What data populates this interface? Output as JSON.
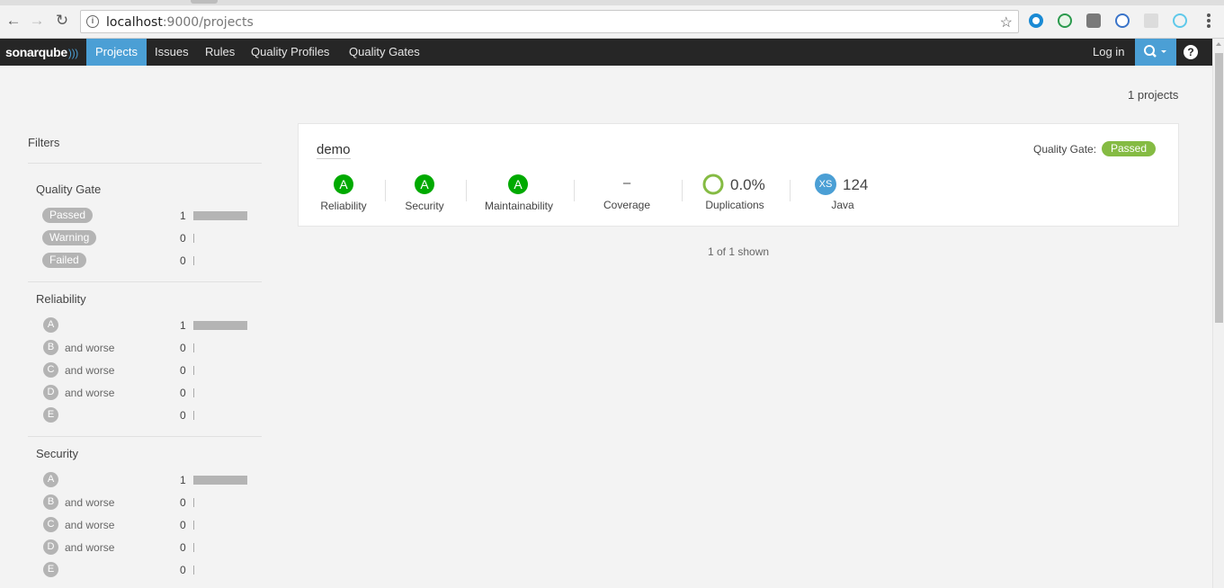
{
  "browser": {
    "url_host": "localhost",
    "url_rest": ":9000/projects"
  },
  "nav": {
    "logo": "sonarqube",
    "items": [
      {
        "label": "Projects"
      },
      {
        "label": "Issues"
      },
      {
        "label": "Rules"
      },
      {
        "label": "Quality Profiles"
      },
      {
        "label": "Quality Gates"
      }
    ],
    "login": "Log in",
    "help": "?"
  },
  "filters": {
    "title": "Filters",
    "quality_gate": {
      "heading": "Quality Gate",
      "rows": [
        {
          "label": "Passed",
          "count": "1"
        },
        {
          "label": "Warning",
          "count": "0"
        },
        {
          "label": "Failed",
          "count": "0"
        }
      ]
    },
    "reliability": {
      "heading": "Reliability",
      "rows": [
        {
          "grade": "A",
          "suffix": "",
          "count": "1"
        },
        {
          "grade": "B",
          "suffix": "and worse",
          "count": "0"
        },
        {
          "grade": "C",
          "suffix": "and worse",
          "count": "0"
        },
        {
          "grade": "D",
          "suffix": "and worse",
          "count": "0"
        },
        {
          "grade": "E",
          "suffix": "",
          "count": "0"
        }
      ]
    },
    "security": {
      "heading": "Security",
      "rows": [
        {
          "grade": "A",
          "suffix": "",
          "count": "1"
        },
        {
          "grade": "B",
          "suffix": "and worse",
          "count": "0"
        },
        {
          "grade": "C",
          "suffix": "and worse",
          "count": "0"
        },
        {
          "grade": "D",
          "suffix": "and worse",
          "count": "0"
        },
        {
          "grade": "E",
          "suffix": "",
          "count": "0"
        }
      ]
    }
  },
  "main": {
    "project_count": "1 projects",
    "project": {
      "name": "demo",
      "quality_gate_label": "Quality Gate:",
      "quality_gate_status": "Passed",
      "measures": {
        "reliability": {
          "value": "A",
          "label": "Reliability"
        },
        "security": {
          "value": "A",
          "label": "Security"
        },
        "maintainability": {
          "value": "A",
          "label": "Maintainability"
        },
        "coverage": {
          "value": "–",
          "label": "Coverage"
        },
        "duplications": {
          "value": "0.0%",
          "label": "Duplications"
        },
        "size": {
          "badge": "XS",
          "value": "124",
          "label": "Java"
        }
      }
    },
    "shown": "1 of 1 shown"
  },
  "colors": {
    "nav_bg": "#262626",
    "accent": "#4b9fd5",
    "rating_a": "#00aa00",
    "passed": "#85bb43",
    "muted": "#b4b4b4"
  }
}
